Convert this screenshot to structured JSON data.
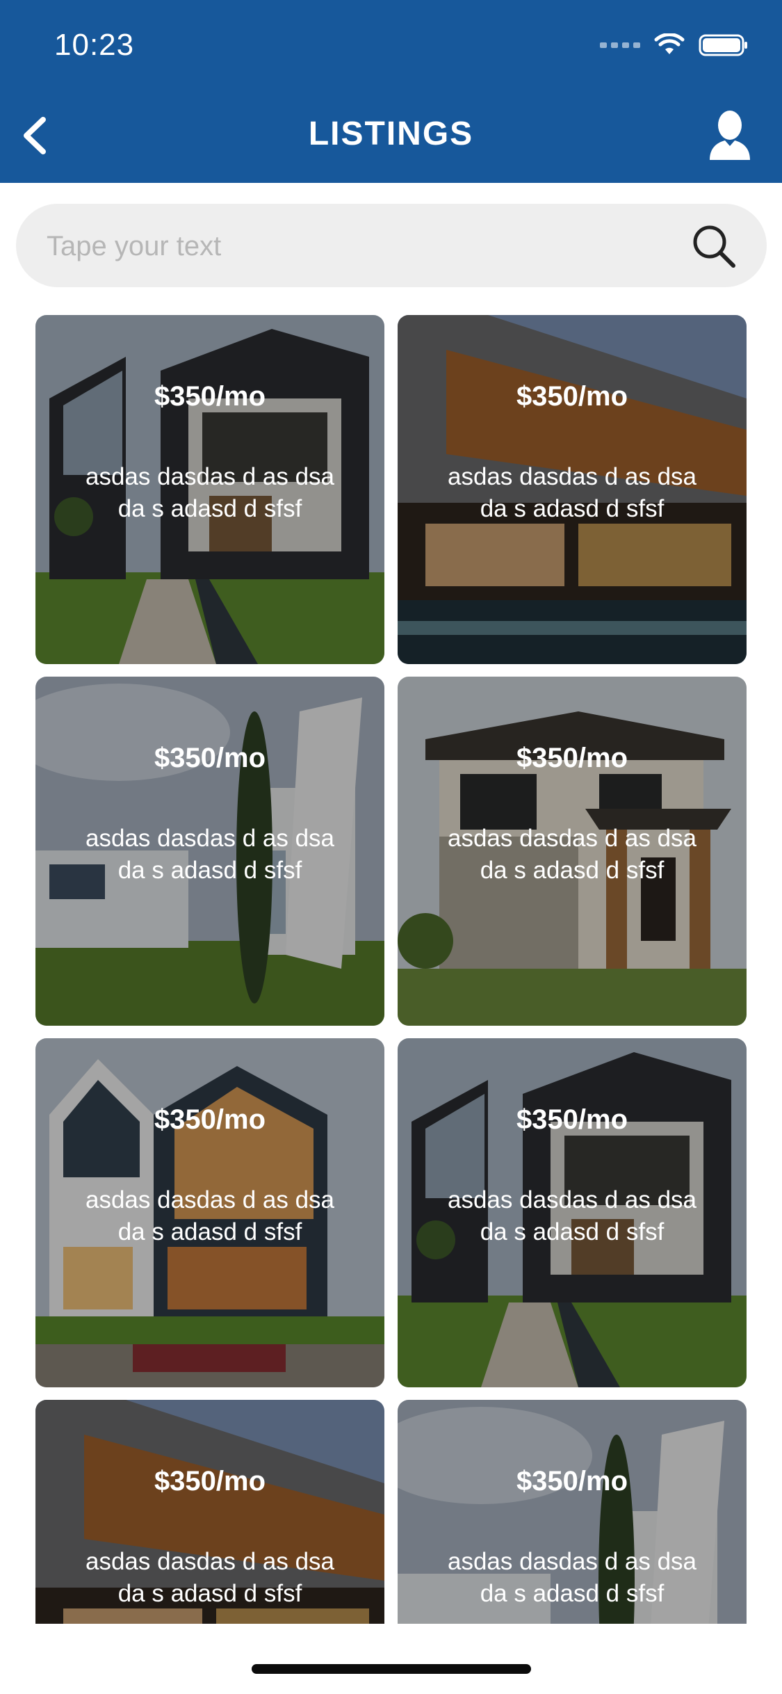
{
  "status": {
    "time": "10:23"
  },
  "nav": {
    "title": "LISTINGS"
  },
  "search": {
    "placeholder": "Tape your text",
    "value": ""
  },
  "colors": {
    "header": "#17589b",
    "search_bg": "#eeeeee"
  },
  "listings": [
    {
      "price": "$350/mo",
      "description": "asdas dasdas d as dsa da s adasd  d sfsf"
    },
    {
      "price": "$350/mo",
      "description": "asdas dasdas d as dsa da s adasd  d sfsf"
    },
    {
      "price": "$350/mo",
      "description": "asdas dasdas d as dsa da s adasd  d sfsf"
    },
    {
      "price": "$350/mo",
      "description": "asdas dasdas d as dsa da s adasd  d sfsf"
    },
    {
      "price": "$350/mo",
      "description": "asdas dasdas d as dsa da s adasd  d sfsf"
    },
    {
      "price": "$350/mo",
      "description": "asdas dasdas d as dsa da s adasd  d sfsf"
    },
    {
      "price": "$350/mo",
      "description": "asdas dasdas d as dsa da s adasd  d sfsf"
    },
    {
      "price": "$350/mo",
      "description": "asdas dasdas d as dsa da s adasd  d sfsf"
    }
  ]
}
